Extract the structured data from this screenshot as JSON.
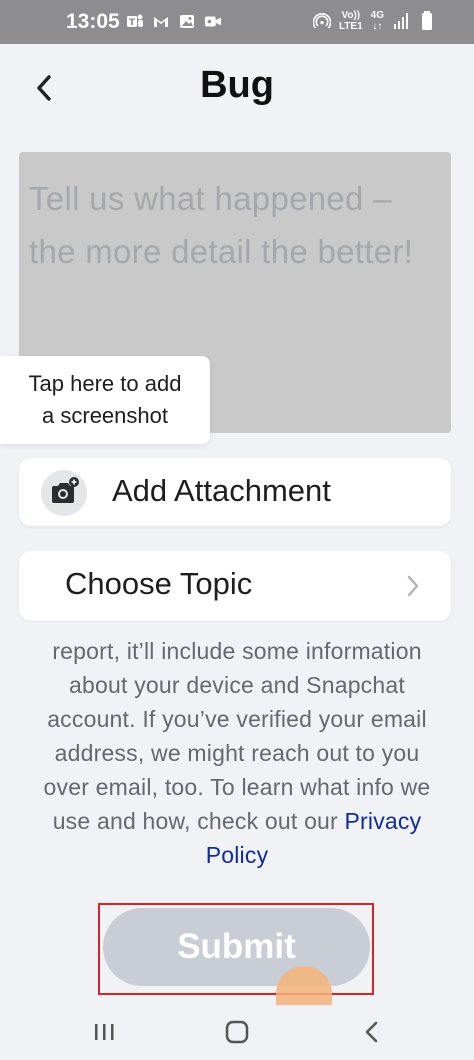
{
  "status_bar": {
    "time": "13:05",
    "left_icons": [
      "teams-icon",
      "gmail-icon",
      "gallery-icon",
      "video-icon"
    ],
    "network_top": "Vo))",
    "network_bottom": "LTE1",
    "network_type": "4G",
    "right_icons": [
      "hotspot-icon",
      "signal-icon",
      "battery-icon"
    ]
  },
  "header": {
    "title": "Bug",
    "back_icon": "chevron-left-icon"
  },
  "description": {
    "placeholder": "Tell us what happened – the more detail the better!"
  },
  "tooltip": {
    "line1": "Tap here to add",
    "line2": "a screenshot"
  },
  "attachment": {
    "label": "Add Attachment",
    "icon": "camera-add-icon"
  },
  "topic": {
    "label": "Choose Topic",
    "icon": "chevron-right-icon"
  },
  "info": {
    "line1": "report, it’ll include some information",
    "line2": "about your device and Snapchat",
    "line3": "account. If you’ve verified your email",
    "line4": "address, we might reach out to you",
    "line5": "over email, too. To learn what info we",
    "line6_prefix": "use and how, check out our ",
    "link_part1": "Privacy",
    "link_part2": "Policy"
  },
  "submit": {
    "label": "Submit"
  },
  "colors": {
    "status_bar": "#8d8d90",
    "background": "#f1f2f6",
    "input_fill": "#c9c9c9",
    "placeholder": "#a4a8ac",
    "link": "#0f2c9e",
    "submit_fill": "#c9ced6",
    "highlight_outline": "#d7242a"
  },
  "nav_bar": {
    "icons": [
      "recent-apps-icon",
      "home-icon",
      "back-icon"
    ]
  }
}
